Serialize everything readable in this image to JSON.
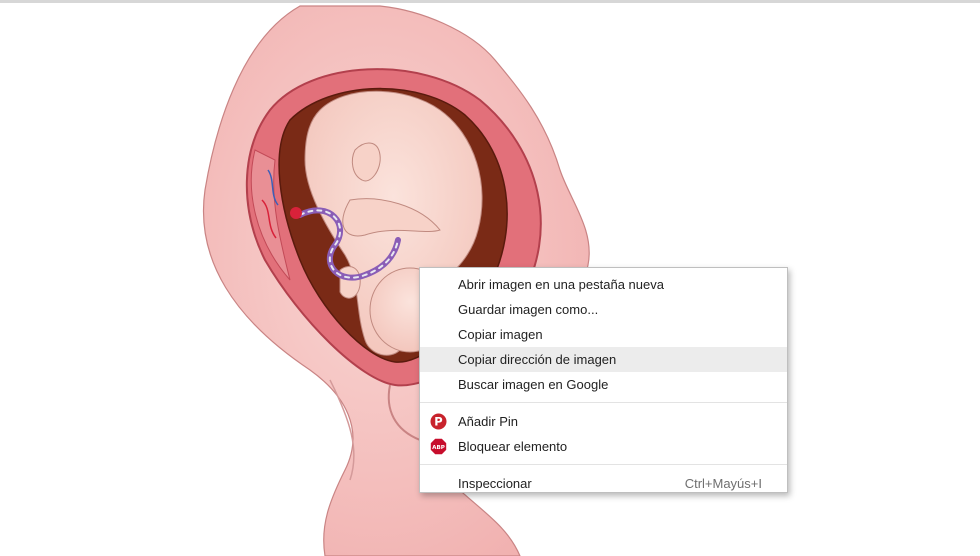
{
  "context_menu": {
    "items_group1": [
      {
        "label": "Abrir imagen en una pestaña nueva"
      },
      {
        "label": "Guardar imagen como..."
      },
      {
        "label": "Copiar imagen"
      },
      {
        "label": "Copiar dirección de imagen"
      },
      {
        "label": "Buscar imagen en Google"
      }
    ],
    "items_group2": [
      {
        "label": "Añadir Pin",
        "icon": "pinterest-icon"
      },
      {
        "label": "Bloquear elemento",
        "icon": "adblock-plus-icon"
      }
    ],
    "items_group3": [
      {
        "label": "Inspeccionar",
        "shortcut": "Ctrl+Mayús+I"
      }
    ],
    "highlighted_label": "Copiar dirección de imagen"
  },
  "icons": {
    "pinterest_badge_text": "P",
    "abp_badge_text": "ABP"
  },
  "colors": {
    "pinterest_red": "#c8232c",
    "abp_red": "#c70d2c",
    "menu_highlight": "#ececec",
    "skin_pink": "#f2b8b8",
    "uterus_red": "#d9535f",
    "placenta_brown": "#7a2a16"
  }
}
